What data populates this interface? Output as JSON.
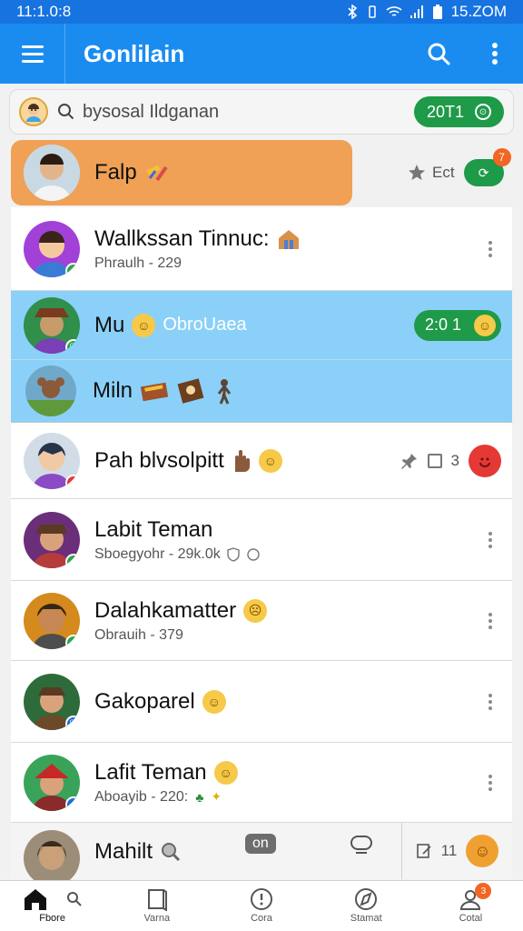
{
  "status_bar": {
    "time": "11:1.0:8",
    "right_text": "15.ZOM"
  },
  "app_bar": {
    "title": "Gonlilain"
  },
  "search": {
    "placeholder": "bysosal Ildganan",
    "count": "20T1"
  },
  "list": {
    "featured": {
      "title": "Falp",
      "action_text": "Ect",
      "badge": "7"
    },
    "items": [
      {
        "title": "Wallkssan Tinnuc:",
        "subtitle": "Phraulh - 229"
      },
      {
        "title": "Mu",
        "accent": "ObroUaea",
        "pill": "2:0 1"
      },
      {
        "title": "Miln"
      },
      {
        "title": "Pah blvsolpitt",
        "side_number": "3"
      },
      {
        "title": "Labit Teman",
        "subtitle": "Sboegyohr - 29k.0k"
      },
      {
        "title": "Dalahkamatter",
        "subtitle": "Obrauih - 379"
      },
      {
        "title": "Gakoparel"
      },
      {
        "title": "Lafit Teman",
        "subtitle": "Aboayib - 220:"
      },
      {
        "title": "Mahilt",
        "chip": "on",
        "side_number": "11"
      }
    ]
  },
  "bottom_nav": {
    "items": [
      {
        "label": "Fbore",
        "icon": "home-icon"
      },
      {
        "label": "Varna",
        "icon": "book-icon"
      },
      {
        "label": "Cora",
        "icon": "alert-circle-icon"
      },
      {
        "label": "Stamat",
        "icon": "explore-icon"
      },
      {
        "label": "Cotal",
        "icon": "profile-icon",
        "badge": "3"
      }
    ]
  },
  "colors": {
    "app_bar": "#1a8cf0",
    "status_bar": "#1673e0",
    "featured_row": "#f0a155",
    "selected_row": "#8bd0f8",
    "green_pill": "#1e9a48",
    "red_badge": "#e53935"
  }
}
